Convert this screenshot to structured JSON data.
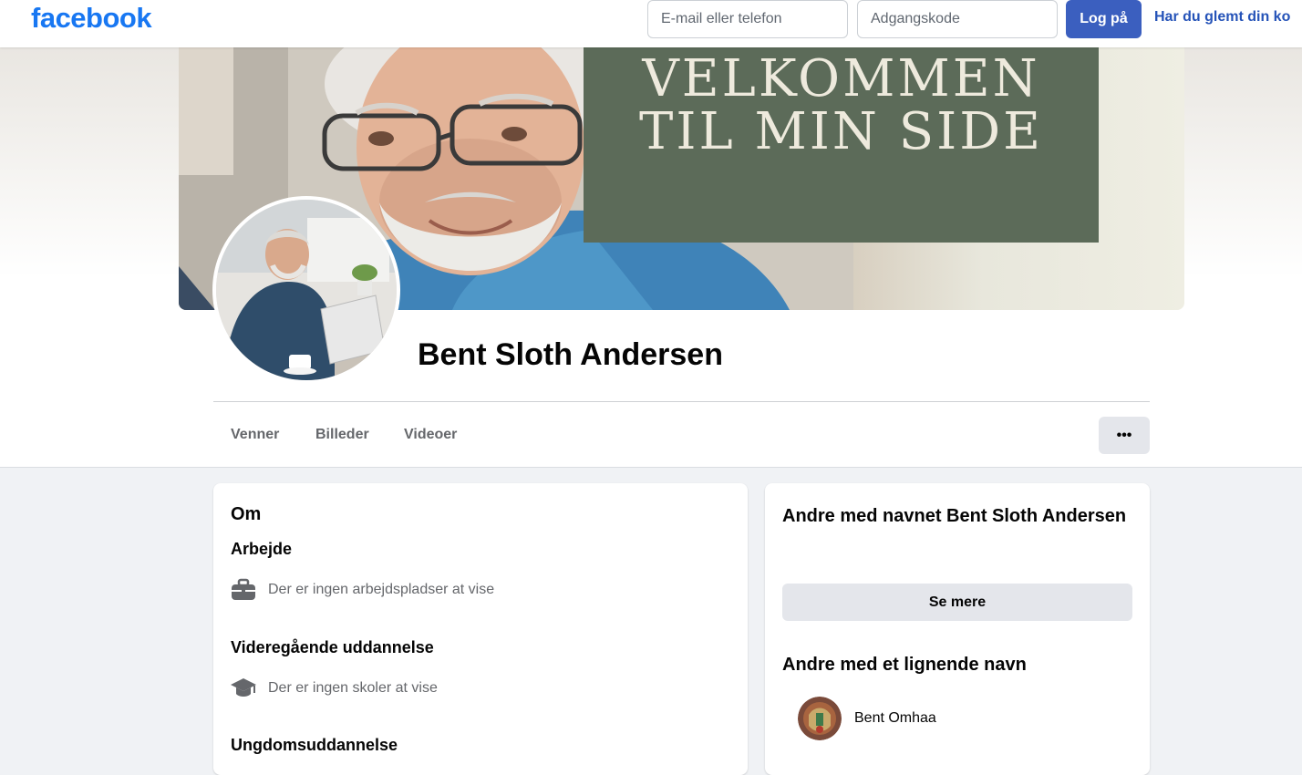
{
  "topbar": {
    "logo": "facebook",
    "email_placeholder": "E-mail eller telefon",
    "password_placeholder": "Adgangskode",
    "login_label": "Log på",
    "forgot_label": "Har du glemt din ko"
  },
  "cover": {
    "banner_line1": "VELKOMMEN",
    "banner_line2": "TIL MIN SIDE",
    "banner_color": "#5c6b59"
  },
  "profile": {
    "name": "Bent Sloth Andersen"
  },
  "tabs": [
    {
      "label": "Venner"
    },
    {
      "label": "Billeder"
    },
    {
      "label": "Videoer"
    }
  ],
  "more_button": "•••",
  "about": {
    "title": "Om",
    "work_heading": "Arbejde",
    "work_empty": "Der er ingen arbejdspladser at vise",
    "highschool_heading": "Videregående uddannelse",
    "highschool_empty": "Der er ingen skoler at vise",
    "youth_heading": "Ungdomsuddannelse"
  },
  "others": {
    "same_name_title": "Andre med navnet Bent Sloth Andersen",
    "see_more": "Se mere",
    "similar_title": "Andre med et lignende navn",
    "similar_people": [
      {
        "name": "Bent Omhaa"
      }
    ]
  },
  "colors": {
    "brand": "#1877f2",
    "login_button": "#3b5fbf",
    "muted_text": "#65676b",
    "page_bg": "#f0f2f5"
  }
}
